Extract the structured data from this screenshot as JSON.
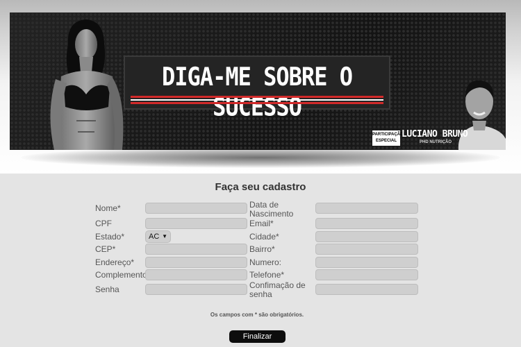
{
  "banner": {
    "title": "DIGA-ME SOBRE O SUCESSO",
    "participation": "PARTICIPAÇÃO ESPECIAL",
    "presenter": "LUCIANO BRUNO",
    "presenter_subtitle": "PHD NUTRIÇÃO",
    "accent_color": "#d22a2a"
  },
  "form": {
    "title": "Faça seu cadastro",
    "labels": {
      "nome": "Nome*",
      "data_nascimento": "Data de Nascimento",
      "cpf": "CPF",
      "email": "Email*",
      "estado": "Estado*",
      "cidade": "Cidade*",
      "cep": "CEP*",
      "bairro": "Bairro*",
      "endereco": "Endereço*",
      "numero": "Numero:",
      "complemento": "Complemento",
      "telefone": "Telefone*",
      "senha": "Senha",
      "confirmacao_senha": "Confimação de senha"
    },
    "estado_selected": "AC",
    "required_note": "Os campos com * são obrigatórios.",
    "submit_label": "Finalizar"
  }
}
